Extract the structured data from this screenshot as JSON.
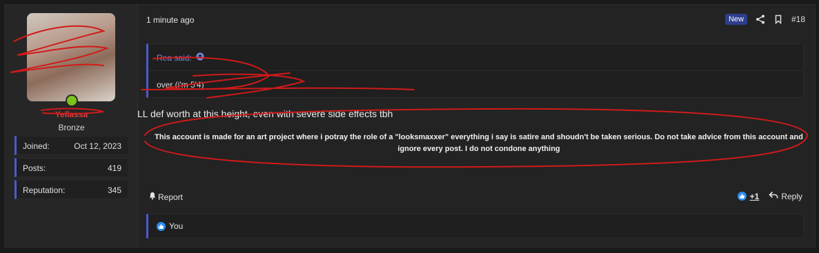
{
  "user": {
    "username": "Yellassa",
    "rank": "Bronze",
    "stats": [
      {
        "label": "Joined:",
        "value": "Oct 12, 2023"
      },
      {
        "label": "Posts:",
        "value": "419"
      },
      {
        "label": "Reputation:",
        "value": "345"
      }
    ]
  },
  "header": {
    "time": "1 minute ago",
    "badge": "New",
    "post_number": "#18"
  },
  "quote": {
    "author_label": "Rea said:",
    "text": "over (i'm 5'4)"
  },
  "post": {
    "body": "LL def worth at this height, even with severe side effects tbh",
    "disclaimer": "This account is made for an art project where i potray the role of a \"looksmaxxer\" everything i say is satire and shoudn't be taken serious. Do not take advice from this account and ignore every post. I do not condone anything"
  },
  "footer": {
    "report_label": "Report",
    "like_count": "+1",
    "reply_label": "Reply"
  },
  "reactions": {
    "text": "You"
  },
  "colors": {
    "accent": "#4a5bd1",
    "like": "#2d8cf0",
    "online": "#7cc41a",
    "scribble": "#d11a1a"
  }
}
